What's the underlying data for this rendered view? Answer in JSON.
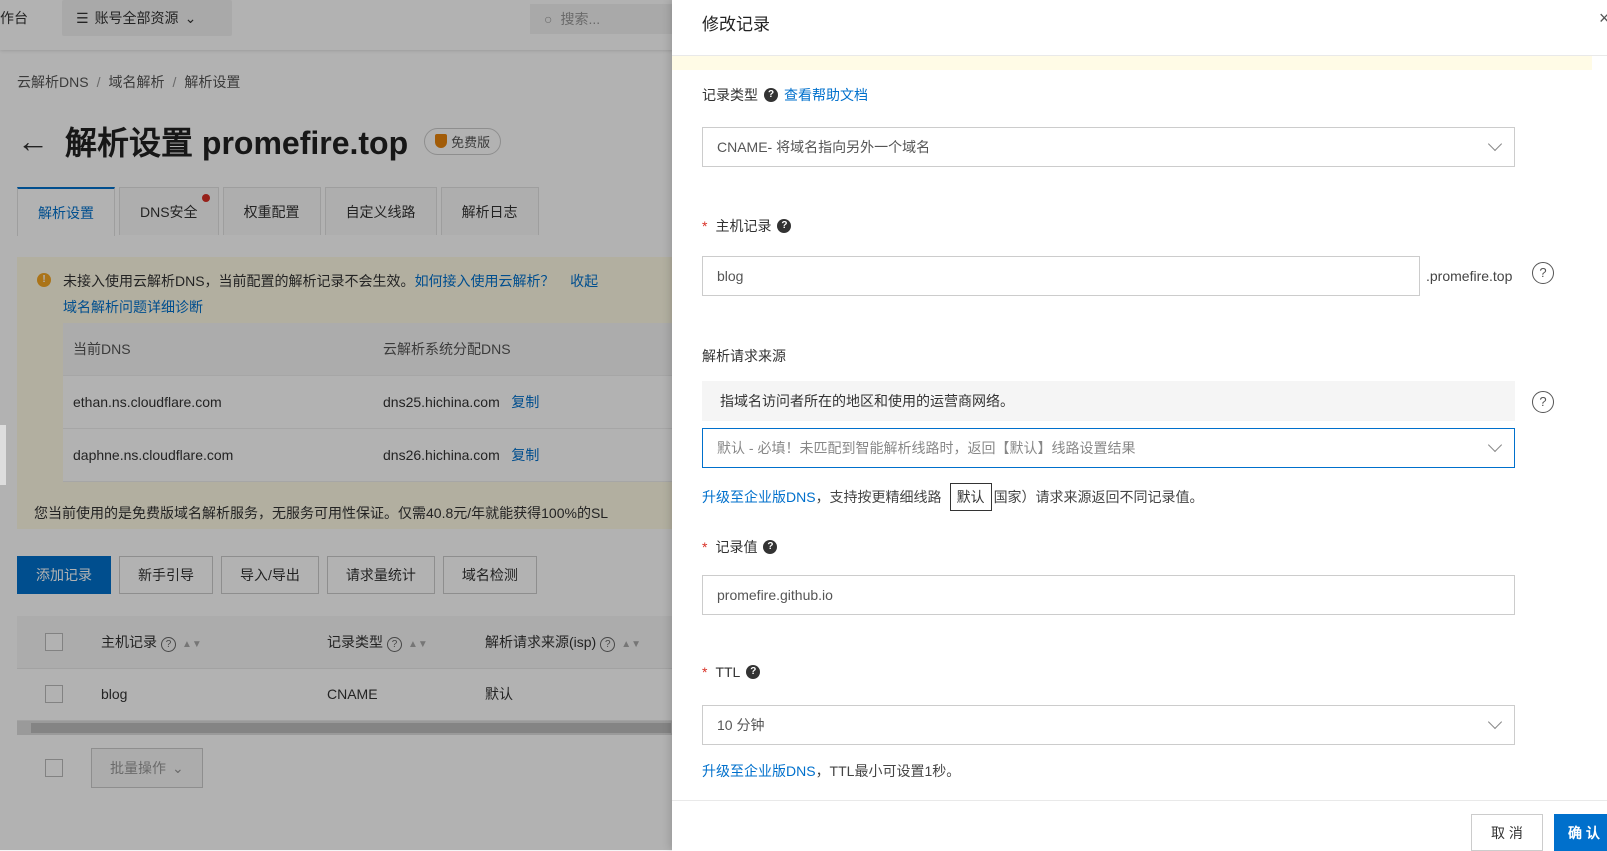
{
  "topbar": {
    "workspace": "作台",
    "resources": "账号全部资源",
    "search_placeholder": "搜索..."
  },
  "breadcrumb": [
    "云解析DNS",
    "域名解析",
    "解析设置"
  ],
  "page": {
    "title": "解析设置 promefire.top",
    "badge": "免费版"
  },
  "tabs": [
    "解析设置",
    "DNS安全",
    "权重配置",
    "自定义线路",
    "解析日志"
  ],
  "notice": {
    "text": "未接入使用云解析DNS，当前配置的解析记录不会生效。",
    "link1": "如何接入使用云解析？",
    "link2": "收起",
    "link3": "域名解析问题详细诊断",
    "table_headers": [
      "当前DNS",
      "云解析系统分配DNS"
    ],
    "rows": [
      {
        "current": "ethan.ns.cloudflare.com",
        "assigned": "dns25.hichina.com",
        "copy": "复制"
      },
      {
        "current": "daphne.ns.cloudflare.com",
        "assigned": "dns26.hichina.com",
        "copy": "复制"
      }
    ],
    "footer": "您当前使用的是免费版域名解析服务，无服务可用性保证。仅需40.8元/年就能获得100%的SL"
  },
  "actions": [
    "添加记录",
    "新手引导",
    "导入/导出",
    "请求量统计",
    "域名检测"
  ],
  "records": {
    "headers": [
      "主机记录",
      "记录类型",
      "解析请求来源(isp)"
    ],
    "row": {
      "host": "blog",
      "type": "CNAME",
      "line": "默认"
    },
    "bulk": "批量操作"
  },
  "drawer": {
    "title": "修改记录",
    "record_type_label": "记录类型",
    "help_doc": "查看帮助文档",
    "record_type_value": "CNAME- 将域名指向另外一个域名",
    "host_label": "主机记录",
    "host_value": "blog",
    "host_suffix": ".promefire.top",
    "source_label": "解析请求来源",
    "source_tip": "指域名访问者所在的地区和使用的运营商网络。",
    "source_value": "默认 - 必填！未匹配到智能解析线路时，返回【默认】线路设置结果",
    "upgrade_link": "升级至企业版DNS",
    "upgrade_text_a": "，支持按更精细线路",
    "tooltip": "默认",
    "upgrade_text_b": "国家）请求来源返回不同记录值。",
    "value_label": "记录值",
    "value_value": "promefire.github.io",
    "ttl_label": "TTL",
    "ttl_value": "10 分钟",
    "ttl_upgrade_link": "升级至企业版DNS",
    "ttl_note": "，TTL最小可设置1秒。",
    "cancel": "取 消",
    "confirm": "确 认"
  }
}
